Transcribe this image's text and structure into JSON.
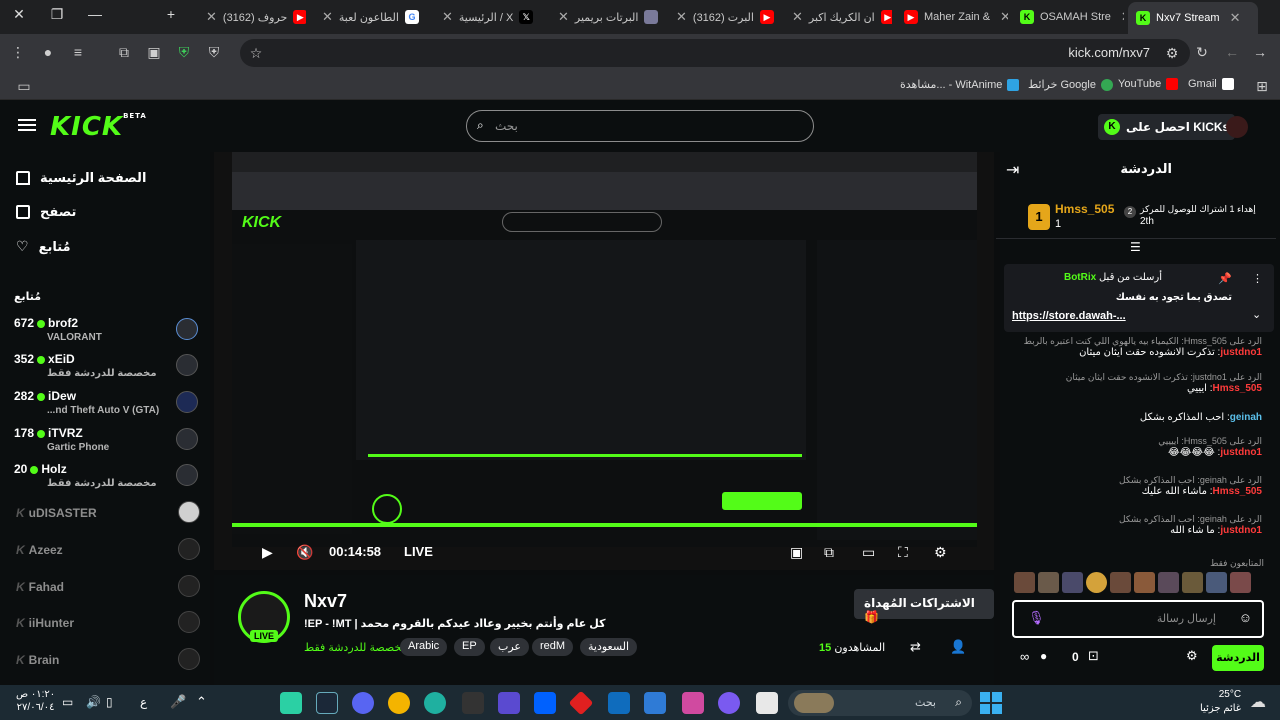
{
  "browser": {
    "tabs": [
      {
        "label": "Nxv7 Stream",
        "favicon": "kick",
        "active": true
      },
      {
        "label": "OSAMAH Stre",
        "favicon": "kick"
      },
      {
        "label": "Maher Zain &",
        "favicon": "youtube"
      },
      {
        "label": "ان الكريك اكبر",
        "favicon": "youtube"
      },
      {
        "label": "(3162) البرت",
        "favicon": "youtube"
      },
      {
        "label": "البرتات بريمير",
        "favicon": "site"
      },
      {
        "label": "الرئيسية / X",
        "favicon": "x"
      },
      {
        "label": "الطاعون لعبة",
        "favicon": "google"
      },
      {
        "label": "(3162) حروف",
        "favicon": "youtube"
      }
    ],
    "url": "kick.com/nxv7",
    "bookmarks": [
      "Gmail",
      "YouTube",
      "خرائط Google",
      "مشاهدة... - WitAnime"
    ]
  },
  "kick": {
    "logo": "KICK",
    "logo_beta": "BETA",
    "search_placeholder": "بحث",
    "get_kicks": "احصل على KICKs"
  },
  "sidebar": {
    "nav": [
      "الصفحة الرئيسية",
      "تصفح",
      "مُتابع"
    ],
    "section_title": "مُتابع",
    "live_channels": [
      {
        "viewers": "672",
        "name": "brof2",
        "game": "VALORANT"
      },
      {
        "viewers": "352",
        "name": "xEiD",
        "game": "مخصصة للدردشة فقط"
      },
      {
        "viewers": "282",
        "name": "iDew",
        "game": "...nd Theft Auto V (GTA)"
      },
      {
        "viewers": "178",
        "name": "iTVRZ",
        "game": "Gartic Phone"
      },
      {
        "viewers": "20",
        "name": "Holz",
        "game": "مخصصة للدردشة فقط"
      }
    ],
    "offline_channels": [
      "uDISASTER",
      "Azeez",
      "Fahad",
      "iiHunter",
      "Brain"
    ]
  },
  "player": {
    "time": "00:14:58",
    "live_label": "LIVE"
  },
  "stream": {
    "name": "Nxv7",
    "title": "!EP - !MT | كل عام وأنتم بخيير وعااد عيدكم بالقروم محمد",
    "category": "مخصصة للدردشة فقط",
    "live_badge": "LIVE",
    "tags": [
      "Arabic",
      "EP",
      "عرب",
      "redM",
      "السعودية"
    ],
    "gift_button": "الاشتراكات المُهداة",
    "viewers_count": "15",
    "viewers_label": "المشاهدون"
  },
  "chat": {
    "title": "الدردشة",
    "leader": {
      "name": "Hmss_505",
      "rank": "1",
      "count": "1",
      "note": "إهداء 1 اشتراك للوصول للمركز",
      "place": "2th"
    },
    "pinned": {
      "by": "أرسلت من قبل",
      "user": "BotRix",
      "text": "تصدق بما تجود به نفسك",
      "link": "https://store.dawah-..."
    },
    "messages": [
      {
        "reply": "الرد على Hmss_505: الكيمياء بيه يالهوي اللي كنت اعتبره بالربط",
        "user": "justdno1",
        "text": "تذكرت الانشوده حقت ايثان ميثان"
      },
      {
        "reply": "الرد على justdno1: تذكرت الانشوده حقت ايثان ميثان",
        "user": "Hmss_505",
        "text": "ايييي"
      },
      {
        "reply": "",
        "user": "geinah",
        "text": "احب المذاكره بشكل"
      },
      {
        "reply": "الرد على Hmss_505: اييييي",
        "user": "justdno1",
        "text": "😂😂😂😂"
      },
      {
        "reply": "الرد على geinah: احب المذاكره بشكل",
        "user": "Hmss_505",
        "text": "ماشاء الله عليك"
      },
      {
        "reply": "الرد على geinah: احب المذاكره بشكل",
        "user": "justdno1",
        "text": "ما شاء الله"
      }
    ],
    "followers_only": "المتابعون فقط",
    "input_placeholder": "إرسال رسالة",
    "send_label": "الدردشة",
    "points": "0"
  },
  "taskbar": {
    "search_placeholder": "بحث",
    "weather_temp": "25°C",
    "weather_desc": "غائم جزئيا",
    "time": "٠١:٢٠ ص",
    "date": "٢٧/٠٦/٠٤",
    "lang": "ع"
  },
  "colors": {
    "kick_green": "#53fc18",
    "background": "#0b0e0f"
  }
}
